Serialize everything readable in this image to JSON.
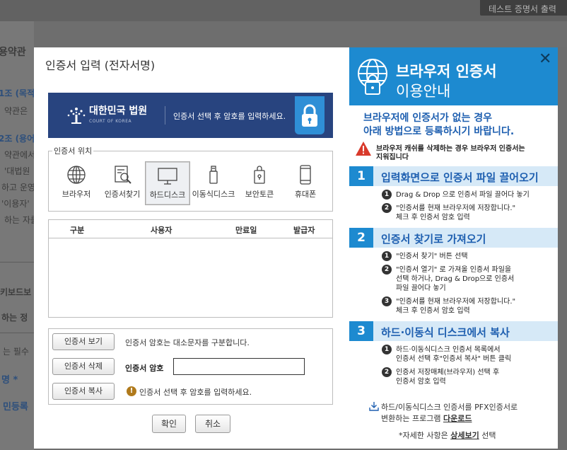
{
  "background": {
    "print_button": "테스트 증명서 출력",
    "lines": [
      "용약관",
      "1조 (목적",
      "약관은",
      "2조 (용어",
      "약관에서",
      "'대법원",
      "하고 운영",
      "'이용자'",
      "하는 자를",
      "키보드보",
      "하는 정",
      "는 필수",
      "명 *",
      "민등록"
    ]
  },
  "dialog": {
    "title": "인증서 입력 (전자서명)",
    "banner": {
      "brand": "대한민국 법원",
      "brand_sub": "COURT OF KOREA",
      "guide": "인증서 선택 후 암호를 입력하세요."
    },
    "location": {
      "legend": "인증서 위치",
      "items": [
        {
          "label": "브라우저",
          "icon": "globe-icon"
        },
        {
          "label": "인증서찾기",
          "icon": "search-cert-icon"
        },
        {
          "label": "하드디스크",
          "icon": "monitor-icon"
        },
        {
          "label": "이동식디스크",
          "icon": "usb-icon"
        },
        {
          "label": "보안토큰",
          "icon": "token-icon"
        },
        {
          "label": "휴대폰",
          "icon": "phone-icon"
        }
      ],
      "selected": "하드디스크"
    },
    "table": {
      "headers": [
        "구분",
        "사용자",
        "만료일",
        "발급자"
      ],
      "rows": []
    },
    "password": {
      "view_button": "인증서 보기",
      "delete_button": "인증서 삭제",
      "copy_button": "인증서 복사",
      "case_note": "인증서 암호는 대소문자를 구분합니다.",
      "label": "인증서 암호",
      "value": "",
      "hint": "인증서 선택 후 암호를 입력하세요."
    },
    "confirm_button": "확인",
    "cancel_button": "취소"
  },
  "guide": {
    "title_line1": "브라우저 인증서",
    "title_line2": "이용안내",
    "intro_line1": "브라우저에 인증서가 없는 경우",
    "intro_line2": "아래 방법으로 등록하시기 바랍니다.",
    "warning_line1": "브라우저 캐쉬를 삭제하는 경우 브라우저 인증서는",
    "warning_line2": "지워집니다",
    "steps": [
      {
        "num": "1",
        "title": "입력화면으로 인증서 파일 끌어오기",
        "bullets": [
          [
            "Drag & Drop 으로 인증서 파일 끌어다 놓기"
          ],
          [
            "\"인증서를 현재 브라우저에 저장합니다.\"",
            "체크 후 인증서 암호 입력"
          ]
        ]
      },
      {
        "num": "2",
        "title": "인증서 찾기로 가져오기",
        "bullets": [
          [
            "\"인증서 찾기\" 버튼 선택"
          ],
          [
            "\"인증서 열기\" 로 가져올 인증서 파일을",
            "선택 하거나, Drag & Drop으로 인증서",
            "파일 끌어다 놓기"
          ],
          [
            "\"인증서를 현재 브라우저에 저장합니다.\"",
            "체크 후 인증서 암호 입력"
          ]
        ]
      },
      {
        "num": "3",
        "title": "하드·이동식 디스크에서 복사",
        "bullets": [
          [
            "하드·이동식디스크 인증서 목록에서",
            "인증서 선택 후\"인증서 복사\" 버튼 클릭"
          ],
          [
            "인증서 저장매체(브라우저) 선택 후",
            "인증서 암호 입력"
          ]
        ]
      }
    ],
    "pfx_line1": "하드/이동식디스크 인증서를 PFX인증서로",
    "pfx_line2_prefix": "변환하는 프로그램",
    "pfx_download": "다운로드",
    "detail_prefix": "*자세한 사항은",
    "detail_link": "상세보기",
    "detail_suffix": "선택",
    "close_symbol": "✕"
  },
  "colors": {
    "banner_bg": "#28447f",
    "guide_header": "#1d8ad0",
    "guide_text_blue": "#1e5fb0",
    "step_bar": "#d6e9f7"
  }
}
